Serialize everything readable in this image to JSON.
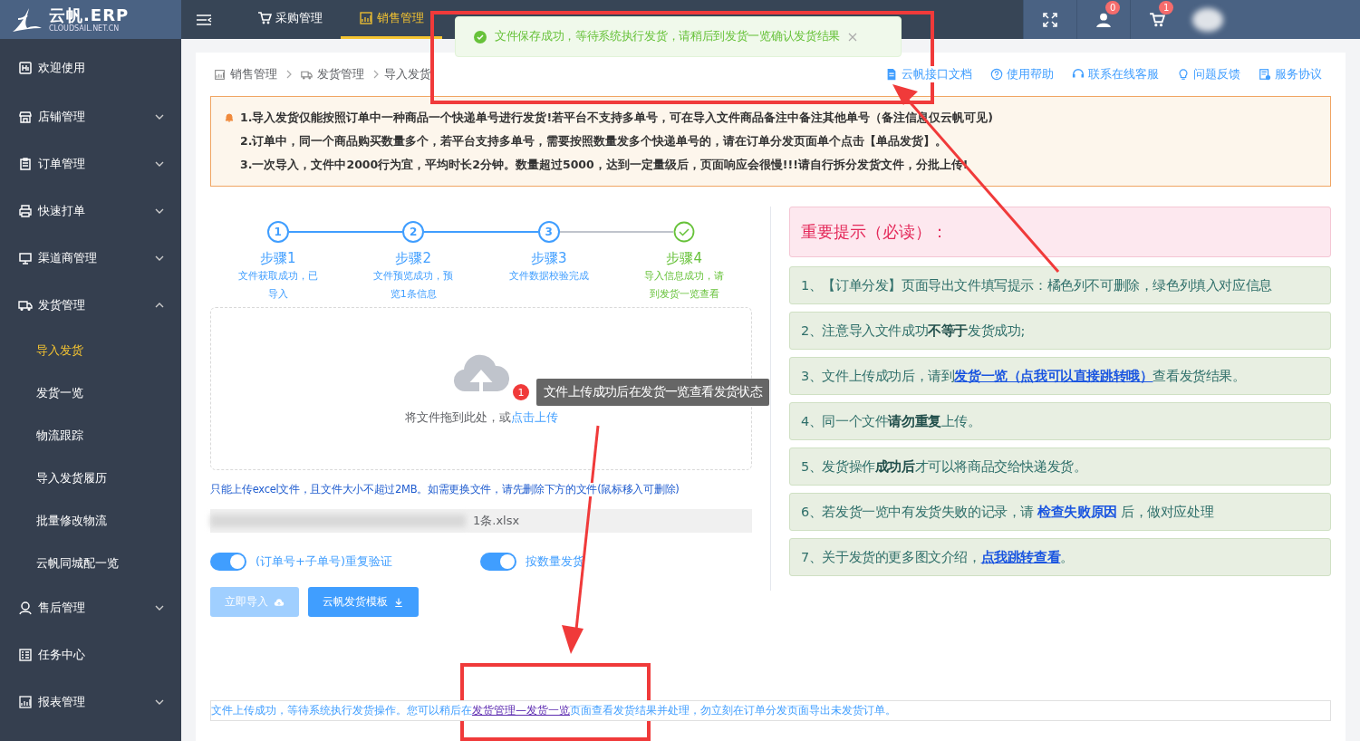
{
  "logo": {
    "name": "云帆.ERP",
    "sub": "CLOUDSAIL.NET.CN"
  },
  "sidebar": {
    "items": [
      {
        "label": "欢迎使用"
      },
      {
        "label": "店铺管理",
        "expanded": false
      },
      {
        "label": "订单管理",
        "expanded": false
      },
      {
        "label": "快速打单",
        "expanded": false
      },
      {
        "label": "渠道商管理",
        "expanded": false
      },
      {
        "label": "发货管理",
        "expanded": true,
        "children": [
          {
            "label": "导入发货",
            "selected": true
          },
          {
            "label": "发货一览",
            "selected": false
          },
          {
            "label": "物流跟踪",
            "selected": false
          },
          {
            "label": "导入发货履历",
            "selected": false
          },
          {
            "label": "批量修改物流",
            "selected": false
          },
          {
            "label": "云帆同城配一览",
            "selected": false
          }
        ]
      },
      {
        "label": "售后管理",
        "expanded": false
      },
      {
        "label": "任务中心"
      },
      {
        "label": "报表管理",
        "expanded": false
      }
    ]
  },
  "topnav": {
    "tabs": [
      {
        "label": "采购管理",
        "selected": false
      },
      {
        "label": "销售管理",
        "selected": true
      }
    ],
    "badges": [
      "0",
      "1"
    ]
  },
  "toast": {
    "message": "文件保存成功，等待系统执行发货，请稍后到发货一览确认发货结果"
  },
  "breadcrumb": [
    "销售管理",
    "发货管理",
    "导入发货"
  ],
  "help_links": [
    "云帆接口文档",
    "使用帮助",
    "联系在线客服",
    "问题反馈",
    "服务协议"
  ],
  "warning": [
    "1.导入发货仅能按照订单中一种商品一个快递单号进行发货!若平台不支持多单号，可在导入文件商品备注中备注其他单号（备注信息仅云帆可见)",
    "2.订单中，同一个商品购买数量多个，若平台支持多单号，需要按照数量发多个快递单号的，请在订单分发页面单个点击【单品发货】。",
    "3.一次导入，文件中2000行为宜，平均时长2分钟。数量超过5000，达到一定量级后，页面响应会很慢!!!请自行拆分发货文件，分批上传!"
  ],
  "steps": [
    {
      "number": "1",
      "title": "步骤1",
      "description": "文件获取成功，已导入",
      "success": false
    },
    {
      "number": "2",
      "title": "步骤2",
      "description": "文件预览成功，预览1条信息",
      "success": false
    },
    {
      "number": "3",
      "title": "步骤3",
      "description": "文件数据校验完成",
      "success": false
    },
    {
      "title": "步骤4",
      "description": "导入信息成功，请到发货一览查看",
      "success": true
    }
  ],
  "upload": {
    "hint": "将文件拖到此处，或",
    "link": "点击上传",
    "note": "只能上传excel文件，且文件大小不超过2MB。如需更换文件，请先删除下方的文件(鼠标移入可删除)",
    "file": "1条.xlsx"
  },
  "tooltip": {
    "badge": "1",
    "text": "文件上传成功后在发货一览查看发货状态"
  },
  "switches": [
    {
      "label": "(订单号+子单号)重复验证",
      "on": true
    },
    {
      "label": "按数量发货",
      "on": true
    }
  ],
  "buttons": [
    {
      "label": "立即导入",
      "disabled": true
    },
    {
      "label": "云帆发货模板",
      "disabled": false
    }
  ],
  "status_message": [
    {
      "text": "文件上传成功，等待系统执行发货操作。您可以稍后在",
      "kind": "plain"
    },
    {
      "text": "发货管理—发货一览",
      "kind": "link"
    },
    {
      "text": "页面查看发货结果并处理，勿立刻在订单分发页面导出未发货订单。",
      "kind": "plain"
    }
  ],
  "notice": {
    "title": "重要提示（必读）：",
    "tips": [
      [
        {
          "text": "1、【订单分发】页面导出文件填写提示：橘色列不可删除，绿色列填入对应信息",
          "kind": "plain"
        }
      ],
      [
        {
          "text": "2、注意导入文件成功",
          "kind": "plain"
        },
        {
          "text": "不等于",
          "kind": "bold"
        },
        {
          "text": "发货成功;",
          "kind": "plain"
        }
      ],
      [
        {
          "text": "3、文件上传成功后，请到",
          "kind": "plain"
        },
        {
          "text": "发货一览（点我可以直接跳转哦）",
          "kind": "link"
        },
        {
          "text": "查看发货结果。",
          "kind": "plain"
        }
      ],
      [
        {
          "text": "4、同一个文件",
          "kind": "plain"
        },
        {
          "text": "请勿重复",
          "kind": "bold"
        },
        {
          "text": "上传。",
          "kind": "plain"
        }
      ],
      [
        {
          "text": "5、发货操作",
          "kind": "plain"
        },
        {
          "text": "成功后",
          "kind": "bold"
        },
        {
          "text": "才可以将商品交给快递发货。",
          "kind": "plain"
        }
      ],
      [
        {
          "text": "6、若发货一览中有发货失败的记录，请 ",
          "kind": "plain"
        },
        {
          "text": "检查失败原因",
          "kind": "bold-link"
        },
        {
          "text": " 后，做对应处理",
          "kind": "plain"
        }
      ],
      [
        {
          "text": "7、关于发货的更多图文介绍，",
          "kind": "plain"
        },
        {
          "text": "点我跳转查看",
          "kind": "link"
        },
        {
          "text": "。",
          "kind": "plain"
        }
      ]
    ]
  }
}
